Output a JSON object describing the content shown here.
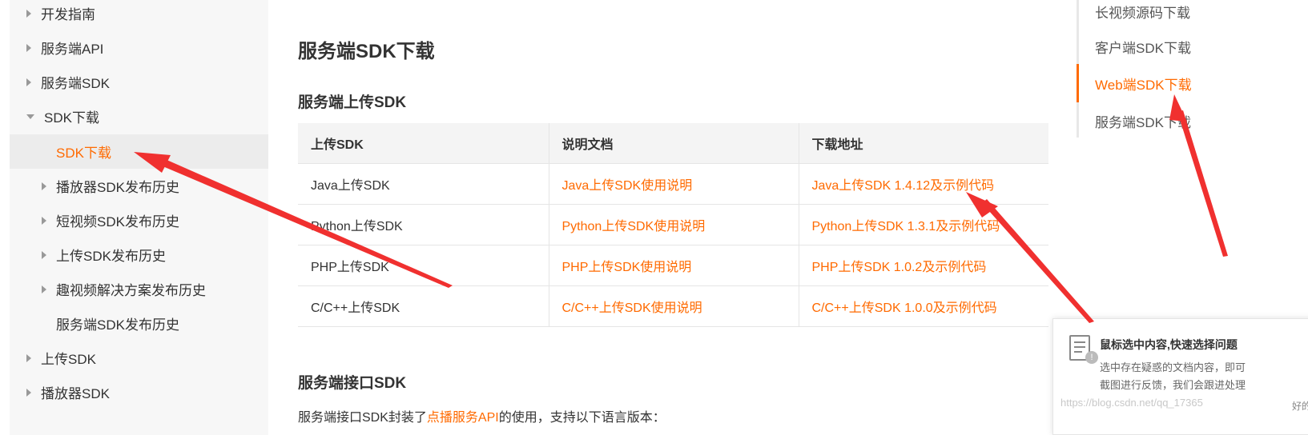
{
  "sidebar": {
    "items": [
      {
        "label": "开发指南"
      },
      {
        "label": "服务端API"
      },
      {
        "label": "服务端SDK"
      },
      {
        "label": "SDK下载"
      },
      {
        "label": "SDK下载"
      },
      {
        "label": "播放器SDK发布历史"
      },
      {
        "label": "短视频SDK发布历史"
      },
      {
        "label": "上传SDK发布历史"
      },
      {
        "label": "趣视频解决方案发布历史"
      },
      {
        "label": "服务端SDK发布历史"
      },
      {
        "label": "上传SDK"
      },
      {
        "label": "播放器SDK"
      }
    ]
  },
  "main": {
    "page_title": "服务端SDK下载",
    "upload_section_title": "服务端上传SDK",
    "table": {
      "headers": [
        "上传SDK",
        "说明文档",
        "下载地址"
      ],
      "rows": [
        [
          "Java上传SDK",
          "Java上传SDK使用说明",
          "Java上传SDK 1.4.12及示例代码"
        ],
        [
          "Python上传SDK",
          "Python上传SDK使用说明",
          "Python上传SDK 1.3.1及示例代码"
        ],
        [
          "PHP上传SDK",
          "PHP上传SDK使用说明",
          "PHP上传SDK 1.0.2及示例代码"
        ],
        [
          "C/C++上传SDK",
          "C/C++上传SDK使用说明",
          "C/C++上传SDK 1.0.0及示例代码"
        ]
      ]
    },
    "api_section_title": "服务端接口SDK",
    "intro": {
      "before": "服务端接口SDK封装了",
      "link": "点播服务API",
      "after": "的使用，支持以下语言版本："
    }
  },
  "toc": {
    "items": [
      {
        "label": "长视频源码下载"
      },
      {
        "label": "客户端SDK下载"
      },
      {
        "label": "Web端SDK下载"
      },
      {
        "label": "服务端SDK下载"
      }
    ]
  },
  "popup": {
    "title": "鼠标选中内容,快速选择问题",
    "line1": "选中存在疑惑的文档内容，即可",
    "line2": "截图进行反馈，我们会跟进处理",
    "ok": "好的"
  },
  "watermark": "https://blog.csdn.net/qq_17365"
}
